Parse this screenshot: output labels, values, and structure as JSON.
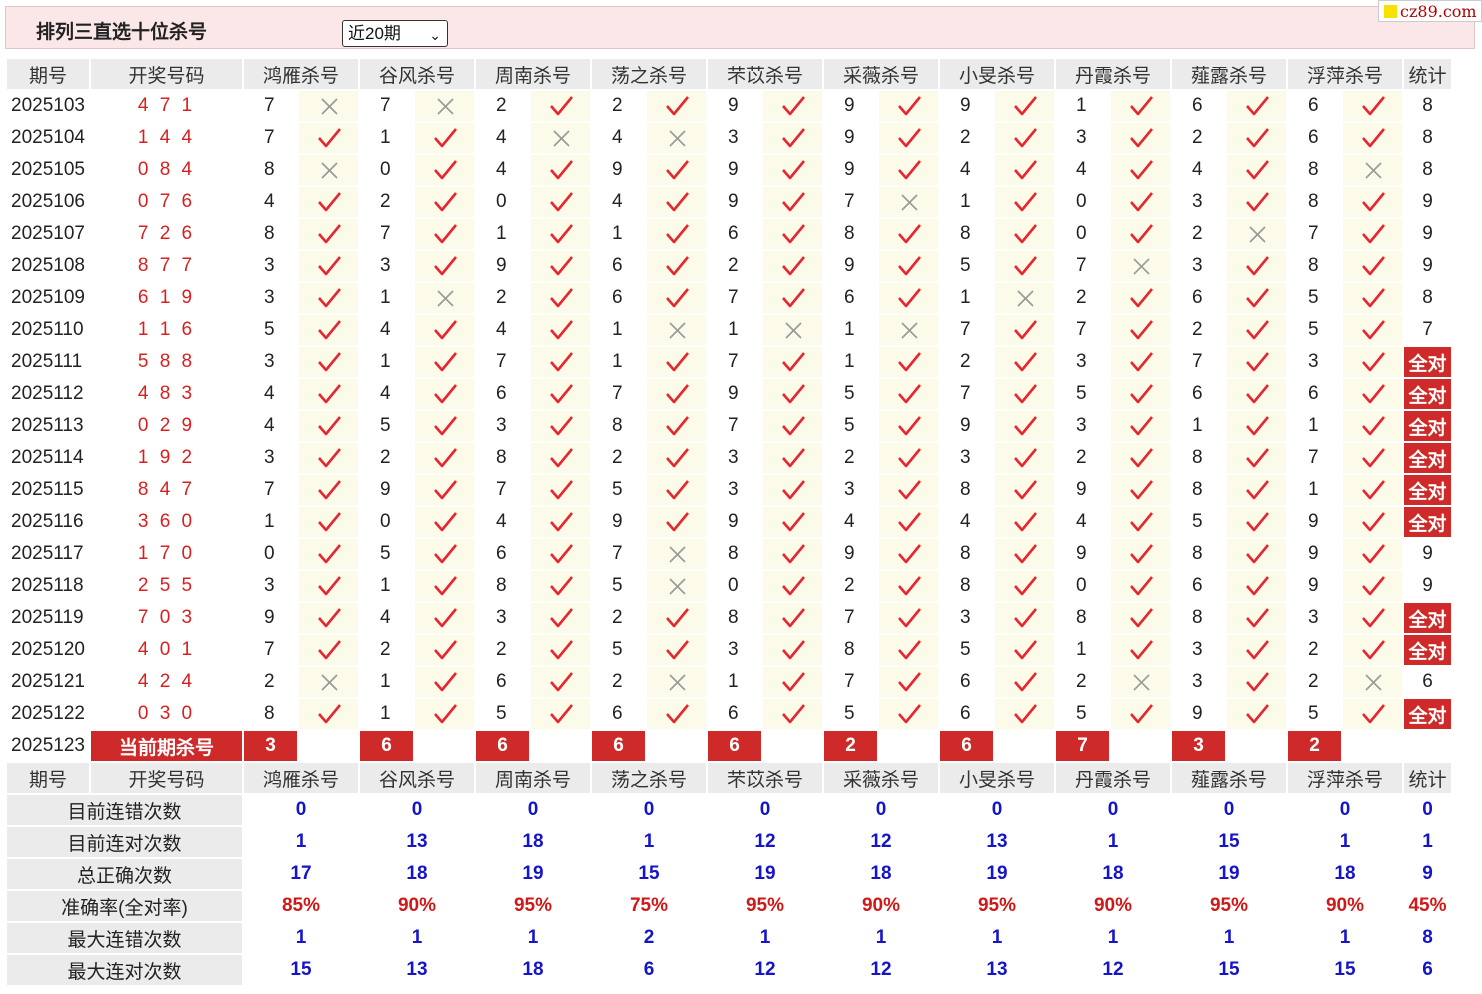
{
  "header": {
    "title": "排列三直选十位杀号",
    "period_select": "近20期",
    "logo_text": "cz89.com"
  },
  "columns": {
    "period": "期号",
    "draw": "开奖号码",
    "experts": [
      "鸿雁杀号",
      "谷风杀号",
      "周南杀号",
      "荡之杀号",
      "芣苡杀号",
      "采薇杀号",
      "小旻杀号",
      "丹霞杀号",
      "薤露杀号",
      "浮萍杀号"
    ],
    "count": "统计"
  },
  "rows": [
    {
      "period": "2025103",
      "draw": "4 7 1",
      "picks": [
        "7",
        "7",
        "2",
        "2",
        "9",
        "9",
        "9",
        "1",
        "6",
        "6"
      ],
      "hits": [
        0,
        0,
        1,
        1,
        1,
        1,
        1,
        1,
        1,
        1
      ],
      "count": "8"
    },
    {
      "period": "2025104",
      "draw": "1 4 4",
      "picks": [
        "7",
        "1",
        "4",
        "4",
        "3",
        "9",
        "2",
        "3",
        "2",
        "6"
      ],
      "hits": [
        1,
        1,
        0,
        0,
        1,
        1,
        1,
        1,
        1,
        1
      ],
      "count": "8"
    },
    {
      "period": "2025105",
      "draw": "0 8 4",
      "picks": [
        "8",
        "0",
        "4",
        "9",
        "9",
        "9",
        "4",
        "4",
        "4",
        "8"
      ],
      "hits": [
        0,
        1,
        1,
        1,
        1,
        1,
        1,
        1,
        1,
        0
      ],
      "count": "8"
    },
    {
      "period": "2025106",
      "draw": "0 7 6",
      "picks": [
        "4",
        "2",
        "0",
        "4",
        "9",
        "7",
        "1",
        "0",
        "3",
        "8"
      ],
      "hits": [
        1,
        1,
        1,
        1,
        1,
        0,
        1,
        1,
        1,
        1
      ],
      "count": "9"
    },
    {
      "period": "2025107",
      "draw": "7 2 6",
      "picks": [
        "8",
        "7",
        "1",
        "1",
        "6",
        "8",
        "8",
        "0",
        "2",
        "7"
      ],
      "hits": [
        1,
        1,
        1,
        1,
        1,
        1,
        1,
        1,
        0,
        1
      ],
      "count": "9"
    },
    {
      "period": "2025108",
      "draw": "8 7 7",
      "picks": [
        "3",
        "3",
        "9",
        "6",
        "2",
        "9",
        "5",
        "7",
        "3",
        "8"
      ],
      "hits": [
        1,
        1,
        1,
        1,
        1,
        1,
        1,
        0,
        1,
        1
      ],
      "count": "9"
    },
    {
      "period": "2025109",
      "draw": "6 1 9",
      "picks": [
        "3",
        "1",
        "2",
        "6",
        "7",
        "6",
        "1",
        "2",
        "6",
        "5"
      ],
      "hits": [
        1,
        0,
        1,
        1,
        1,
        1,
        0,
        1,
        1,
        1
      ],
      "count": "8"
    },
    {
      "period": "2025110",
      "draw": "1 1 6",
      "picks": [
        "5",
        "4",
        "4",
        "1",
        "1",
        "1",
        "7",
        "7",
        "2",
        "5"
      ],
      "hits": [
        1,
        1,
        1,
        0,
        0,
        0,
        1,
        1,
        1,
        1
      ],
      "count": "7"
    },
    {
      "period": "2025111",
      "draw": "5 8 8",
      "picks": [
        "3",
        "1",
        "7",
        "1",
        "7",
        "1",
        "2",
        "3",
        "7",
        "3"
      ],
      "hits": [
        1,
        1,
        1,
        1,
        1,
        1,
        1,
        1,
        1,
        1
      ],
      "count": "全对"
    },
    {
      "period": "2025112",
      "draw": "4 8 3",
      "picks": [
        "4",
        "4",
        "6",
        "7",
        "9",
        "5",
        "7",
        "5",
        "6",
        "6"
      ],
      "hits": [
        1,
        1,
        1,
        1,
        1,
        1,
        1,
        1,
        1,
        1
      ],
      "count": "全对"
    },
    {
      "period": "2025113",
      "draw": "0 2 9",
      "picks": [
        "4",
        "5",
        "3",
        "8",
        "7",
        "5",
        "9",
        "3",
        "1",
        "1"
      ],
      "hits": [
        1,
        1,
        1,
        1,
        1,
        1,
        1,
        1,
        1,
        1
      ],
      "count": "全对"
    },
    {
      "period": "2025114",
      "draw": "1 9 2",
      "picks": [
        "3",
        "2",
        "8",
        "2",
        "3",
        "2",
        "3",
        "2",
        "8",
        "7"
      ],
      "hits": [
        1,
        1,
        1,
        1,
        1,
        1,
        1,
        1,
        1,
        1
      ],
      "count": "全对"
    },
    {
      "period": "2025115",
      "draw": "8 4 7",
      "picks": [
        "7",
        "9",
        "7",
        "5",
        "3",
        "3",
        "8",
        "9",
        "8",
        "1"
      ],
      "hits": [
        1,
        1,
        1,
        1,
        1,
        1,
        1,
        1,
        1,
        1
      ],
      "count": "全对"
    },
    {
      "period": "2025116",
      "draw": "3 6 0",
      "picks": [
        "1",
        "0",
        "4",
        "9",
        "9",
        "4",
        "4",
        "4",
        "5",
        "9"
      ],
      "hits": [
        1,
        1,
        1,
        1,
        1,
        1,
        1,
        1,
        1,
        1
      ],
      "count": "全对"
    },
    {
      "period": "2025117",
      "draw": "1 7 0",
      "picks": [
        "0",
        "5",
        "6",
        "7",
        "8",
        "9",
        "8",
        "9",
        "8",
        "9"
      ],
      "hits": [
        1,
        1,
        1,
        0,
        1,
        1,
        1,
        1,
        1,
        1
      ],
      "count": "9"
    },
    {
      "period": "2025118",
      "draw": "2 5 5",
      "picks": [
        "3",
        "1",
        "8",
        "5",
        "0",
        "2",
        "8",
        "0",
        "6",
        "9"
      ],
      "hits": [
        1,
        1,
        1,
        0,
        1,
        1,
        1,
        1,
        1,
        1
      ],
      "count": "9"
    },
    {
      "period": "2025119",
      "draw": "7 0 3",
      "picks": [
        "9",
        "4",
        "3",
        "2",
        "8",
        "7",
        "3",
        "8",
        "8",
        "3"
      ],
      "hits": [
        1,
        1,
        1,
        1,
        1,
        1,
        1,
        1,
        1,
        1
      ],
      "count": "全对"
    },
    {
      "period": "2025120",
      "draw": "4 0 1",
      "picks": [
        "7",
        "2",
        "2",
        "5",
        "3",
        "8",
        "5",
        "1",
        "3",
        "2"
      ],
      "hits": [
        1,
        1,
        1,
        1,
        1,
        1,
        1,
        1,
        1,
        1
      ],
      "count": "全对"
    },
    {
      "period": "2025121",
      "draw": "4 2 4",
      "picks": [
        "2",
        "1",
        "6",
        "2",
        "1",
        "7",
        "6",
        "2",
        "3",
        "2"
      ],
      "hits": [
        0,
        1,
        1,
        0,
        1,
        1,
        1,
        0,
        1,
        0
      ],
      "count": "6"
    },
    {
      "period": "2025122",
      "draw": "0 3 0",
      "picks": [
        "8",
        "1",
        "5",
        "6",
        "6",
        "5",
        "6",
        "5",
        "9",
        "5"
      ],
      "hits": [
        1,
        1,
        1,
        1,
        1,
        1,
        1,
        1,
        1,
        1
      ],
      "count": "全对"
    }
  ],
  "current": {
    "period": "2025123",
    "label": "当前期杀号",
    "picks": [
      "3",
      "6",
      "6",
      "6",
      "6",
      "2",
      "6",
      "7",
      "3",
      "2"
    ]
  },
  "stats": [
    {
      "label": "目前连错次数",
      "values": [
        "0",
        "0",
        "0",
        "0",
        "0",
        "0",
        "0",
        "0",
        "0",
        "0"
      ],
      "total": "0",
      "color": "#1515c8"
    },
    {
      "label": "目前连对次数",
      "values": [
        "1",
        "13",
        "18",
        "1",
        "12",
        "12",
        "13",
        "1",
        "15",
        "1"
      ],
      "total": "1",
      "color": "#1515c8"
    },
    {
      "label": "总正确次数",
      "values": [
        "17",
        "18",
        "19",
        "15",
        "19",
        "18",
        "19",
        "18",
        "19",
        "18"
      ],
      "total": "9",
      "color": "#1515c8"
    },
    {
      "label": "准确率(全对率)",
      "values": [
        "85%",
        "90%",
        "95%",
        "75%",
        "95%",
        "90%",
        "95%",
        "90%",
        "95%",
        "90%"
      ],
      "total": "45%",
      "color": "#d01818"
    },
    {
      "label": "最大连错次数",
      "values": [
        "1",
        "1",
        "1",
        "2",
        "1",
        "1",
        "1",
        "1",
        "1",
        "1"
      ],
      "total": "8",
      "color": "#1515c8"
    },
    {
      "label": "最大连对次数",
      "values": [
        "15",
        "13",
        "18",
        "6",
        "12",
        "12",
        "13",
        "12",
        "15",
        "15"
      ],
      "total": "6",
      "color": "#1515c8"
    }
  ],
  "colors": {
    "hit": "#e8262f",
    "miss": "#999999",
    "accent": "#cf2a2a"
  }
}
